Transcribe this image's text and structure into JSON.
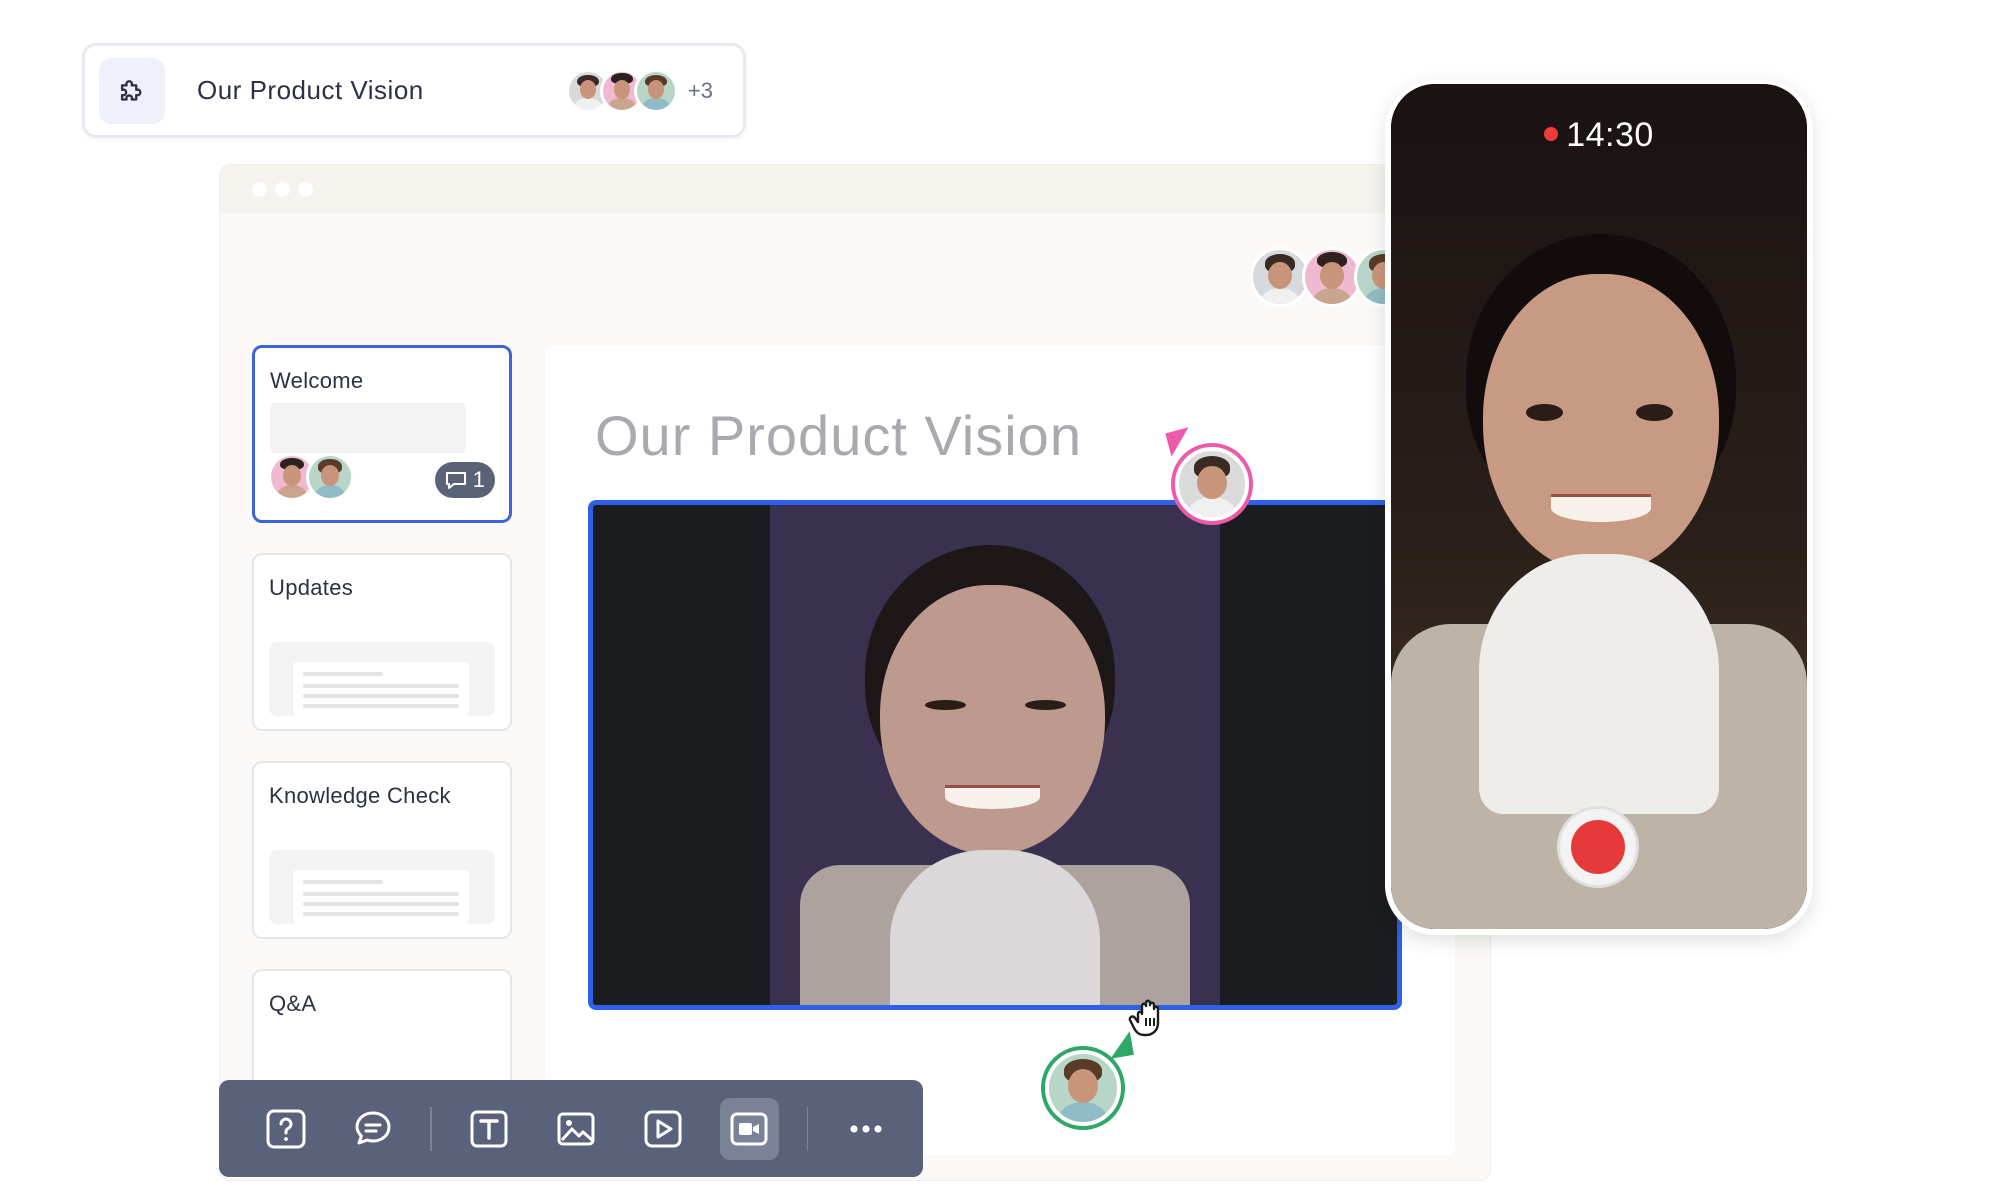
{
  "pill": {
    "title": "Our Product Vision",
    "more_count": "+3"
  },
  "slides": [
    {
      "title": "Welcome",
      "comment_count": "1",
      "active": true
    },
    {
      "title": "Updates",
      "active": false
    },
    {
      "title": "Knowledge Check",
      "active": false
    },
    {
      "title": "Q&A",
      "active": false
    }
  ],
  "canvas": {
    "title": "Our Product Vision"
  },
  "phone": {
    "recording_time": "14:30"
  },
  "colors": {
    "accent_blue": "#2f60e9",
    "record_red": "#e63a3a",
    "cursor_pink": "#ec5aa9",
    "cursor_green": "#2fa766",
    "toolbar_bg": "#59627a"
  },
  "toolbar": {
    "items": [
      {
        "icon": "question-icon",
        "active": false
      },
      {
        "icon": "comment-icon",
        "active": false
      },
      {
        "icon": "text-icon",
        "active": false
      },
      {
        "icon": "image-icon",
        "active": false
      },
      {
        "icon": "play-icon",
        "active": false
      },
      {
        "icon": "video-record-icon",
        "active": true
      },
      {
        "icon": "more-icon",
        "active": false
      }
    ]
  }
}
